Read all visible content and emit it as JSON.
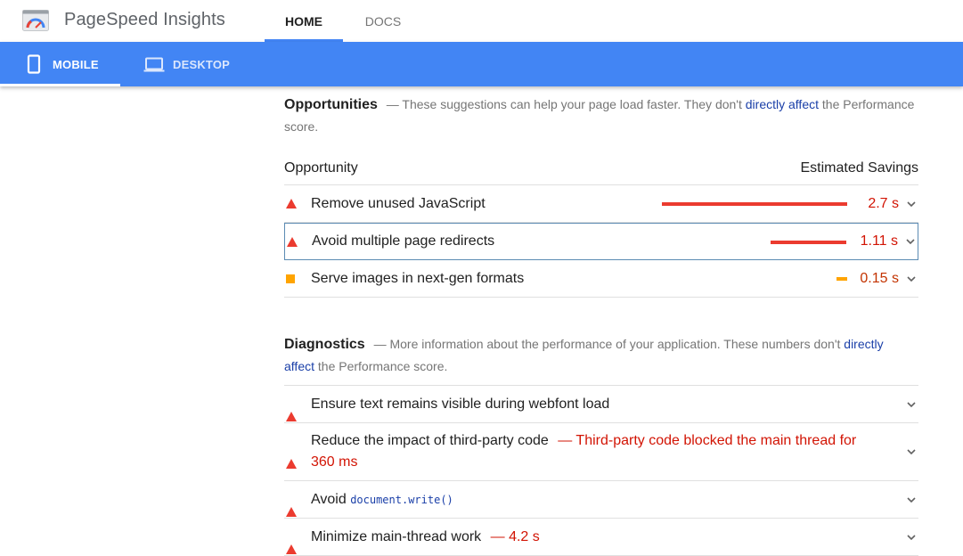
{
  "header": {
    "brand": "PageSpeed Insights",
    "nav": [
      {
        "label": "HOME",
        "active": true
      },
      {
        "label": "DOCS",
        "active": false
      }
    ]
  },
  "device_tabs": [
    {
      "label": "MOBILE",
      "icon": "phone-icon",
      "active": true
    },
    {
      "label": "DESKTOP",
      "icon": "laptop-icon",
      "active": false
    }
  ],
  "opportunities": {
    "title": "Opportunities",
    "desc_before": "— These suggestions can help your page load faster. They don't ",
    "desc_link": "directly affect",
    "desc_after": " the Performance score.",
    "col_left": "Opportunity",
    "col_right": "Estimated Savings",
    "items": [
      {
        "title": "Remove unused JavaScript",
        "savings": "2.7 s",
        "severity": "fail",
        "bar_fraction": 1.0,
        "selected": false
      },
      {
        "title": "Avoid multiple page redirects",
        "savings": "1.11 s",
        "severity": "fail",
        "bar_fraction": 0.41,
        "selected": true
      },
      {
        "title": "Serve images in next-gen formats",
        "savings": "0.15 s",
        "severity": "average",
        "bar_fraction": 0.06,
        "selected": false
      }
    ]
  },
  "diagnostics": {
    "title": "Diagnostics",
    "desc_before": "— More information about the performance of your application. These numbers don't ",
    "desc_link_1": "directly",
    "desc_link_2": "affect",
    "desc_after": " the Performance score.",
    "items": [
      {
        "title": "Ensure text remains visible during webfont load",
        "detail": "",
        "code": ""
      },
      {
        "title": "Reduce the impact of third-party code",
        "detail": "— Third-party code blocked the main thread for 360 ms",
        "code": ""
      },
      {
        "title": "Avoid ",
        "detail": "",
        "code": "document.write()"
      },
      {
        "title": "Minimize main-thread work",
        "detail": "— 4.2 s",
        "code": ""
      }
    ]
  },
  "colors": {
    "accent": "#4285f4",
    "fail": "#eb3b2f",
    "average": "#ffa400",
    "link": "#1a3fa8"
  }
}
